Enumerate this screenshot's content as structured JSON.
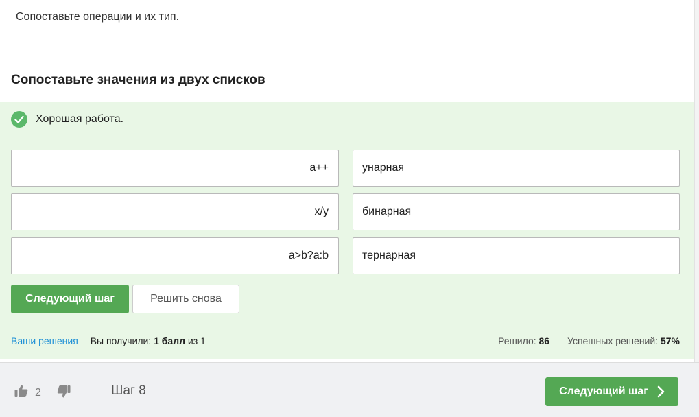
{
  "task": {
    "text": "Сопоставьте операции и их тип."
  },
  "section": {
    "title": "Сопоставьте значения из двух списков"
  },
  "feedback": {
    "text": "Хорошая работа.",
    "icon": "check-circle-icon",
    "color": "#5bb86a"
  },
  "matching": {
    "pairs": [
      {
        "left": "a++",
        "right": "унарная"
      },
      {
        "left": "x/y",
        "right": "бинарная"
      },
      {
        "left": "a>b?a:b",
        "right": "тернарная"
      }
    ]
  },
  "actions": {
    "next_label": "Следующий шаг",
    "retry_label": "Решить снова"
  },
  "stats": {
    "solutions_link": "Ваши решения",
    "got_prefix": "Вы получили:",
    "score": "1 балл",
    "of": "из",
    "max": "1",
    "solved_label": "Решило:",
    "solved_count": "86",
    "success_label": "Успешных решений:",
    "success_rate": "57%"
  },
  "footer": {
    "likes": "2",
    "like_icon": "thumbs-up-icon",
    "dislike_icon": "thumbs-down-icon",
    "step_label": "Шаг 8",
    "next_label": "Следующий шаг",
    "next_icon": "chevron-right-icon"
  },
  "colors": {
    "accent": "#54a854",
    "panel_bg": "#e9f7e6",
    "link": "#1d8fd6"
  }
}
